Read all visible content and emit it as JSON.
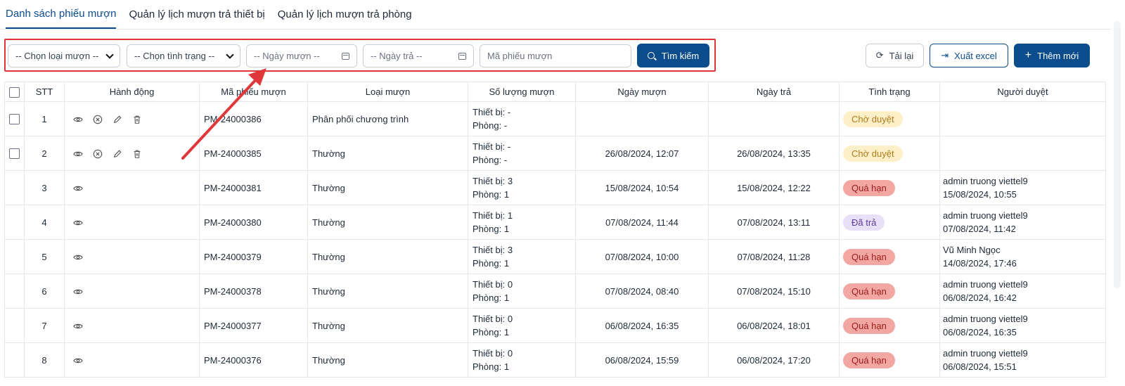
{
  "tabs": [
    {
      "label": "Danh sách phiếu mượn",
      "active": true
    },
    {
      "label": "Quản lý lịch mượn trả thiết bị",
      "active": false
    },
    {
      "label": "Quản lý lịch mượn trả phòng",
      "active": false
    }
  ],
  "filters": {
    "loai_muon": "-- Chọn loại mượn --",
    "tinh_trang": "-- Chọn tình trạng --",
    "ngay_muon": "-- Ngày mượn --",
    "ngay_tra": "-- Ngày trả --",
    "ma_phieu_placeholder": "Mã phiếu mượn",
    "search_label": "Tìm kiếm"
  },
  "toolbar": {
    "reload_label": "Tải lại",
    "export_label": "Xuất excel",
    "add_label": "Thêm mới"
  },
  "table": {
    "headers": [
      "STT",
      "Hành động",
      "Mã phiếu mượn",
      "Loại mượn",
      "Số lượng mượn",
      "Ngày mượn",
      "Ngày trả",
      "Tình trạng",
      "Người duyệt"
    ],
    "rows": [
      {
        "stt": "1",
        "editable": true,
        "ma": "PM-24000386",
        "loai": "Phân phối chương trình",
        "thiet_bi": "Thiết bị: -",
        "phong": "Phòng: -",
        "ngay_muon": "",
        "ngay_tra": "",
        "tinh_trang": "Chờ duyệt",
        "status": "cho",
        "nguoi_duyet": "",
        "ngay_duyet": ""
      },
      {
        "stt": "2",
        "editable": true,
        "ma": "PM-24000385",
        "loai": "Thường",
        "thiet_bi": "Thiết bị: -",
        "phong": "Phòng: -",
        "ngay_muon": "26/08/2024, 12:07",
        "ngay_tra": "26/08/2024, 13:35",
        "tinh_trang": "Chờ duyệt",
        "status": "cho",
        "nguoi_duyet": "",
        "ngay_duyet": ""
      },
      {
        "stt": "3",
        "editable": false,
        "ma": "PM-24000381",
        "loai": "Thường",
        "thiet_bi": "Thiết bị: 3",
        "phong": "Phòng: 1",
        "ngay_muon": "15/08/2024, 10:54",
        "ngay_tra": "15/08/2024, 12:22",
        "tinh_trang": "Quá hạn",
        "status": "qua",
        "nguoi_duyet": "admin truong viettel9",
        "ngay_duyet": "15/08/2024, 10:55"
      },
      {
        "stt": "4",
        "editable": false,
        "ma": "PM-24000380",
        "loai": "Thường",
        "thiet_bi": "Thiết bị: 1",
        "phong": "Phòng: 1",
        "ngay_muon": "07/08/2024, 11:44",
        "ngay_tra": "07/08/2024, 13:11",
        "tinh_trang": "Đã trả",
        "status": "da",
        "nguoi_duyet": "admin truong viettel9",
        "ngay_duyet": "07/08/2024, 11:42"
      },
      {
        "stt": "5",
        "editable": false,
        "ma": "PM-24000379",
        "loai": "Thường",
        "thiet_bi": "Thiết bị: 3",
        "phong": "Phòng: 1",
        "ngay_muon": "07/08/2024, 10:00",
        "ngay_tra": "07/08/2024, 11:28",
        "tinh_trang": "Quá hạn",
        "status": "qua",
        "nguoi_duyet": "Vũ Minh Ngọc",
        "ngay_duyet": "14/08/2024, 17:46"
      },
      {
        "stt": "6",
        "editable": false,
        "ma": "PM-24000378",
        "loai": "Thường",
        "thiet_bi": "Thiết bị: 0",
        "phong": "Phòng: 1",
        "ngay_muon": "07/08/2024, 08:40",
        "ngay_tra": "07/08/2024, 15:10",
        "tinh_trang": "Quá hạn",
        "status": "qua",
        "nguoi_duyet": "admin truong viettel9",
        "ngay_duyet": "06/08/2024, 16:42"
      },
      {
        "stt": "7",
        "editable": false,
        "ma": "PM-24000377",
        "loai": "Thường",
        "thiet_bi": "Thiết bị: 0",
        "phong": "Phòng: 1",
        "ngay_muon": "06/08/2024, 16:35",
        "ngay_tra": "06/08/2024, 18:01",
        "tinh_trang": "Quá hạn",
        "status": "qua",
        "nguoi_duyet": "admin truong viettel9",
        "ngay_duyet": "06/08/2024, 16:35"
      },
      {
        "stt": "8",
        "editable": false,
        "ma": "PM-24000376",
        "loai": "Thường",
        "thiet_bi": "Thiết bị: 0",
        "phong": "Phòng: 1",
        "ngay_muon": "06/08/2024, 15:59",
        "ngay_tra": "06/08/2024, 17:20",
        "tinh_trang": "Quá hạn",
        "status": "qua",
        "nguoi_duyet": "admin truong viettel9",
        "ngay_duyet": "06/08/2024, 15:51"
      }
    ]
  },
  "colors": {
    "primary": "#0b4c8c",
    "annotation": "#e0383a",
    "badge_cho": "#fdf0c8",
    "badge_qua": "#f2a7a3",
    "badge_da": "#e8e0f7"
  }
}
